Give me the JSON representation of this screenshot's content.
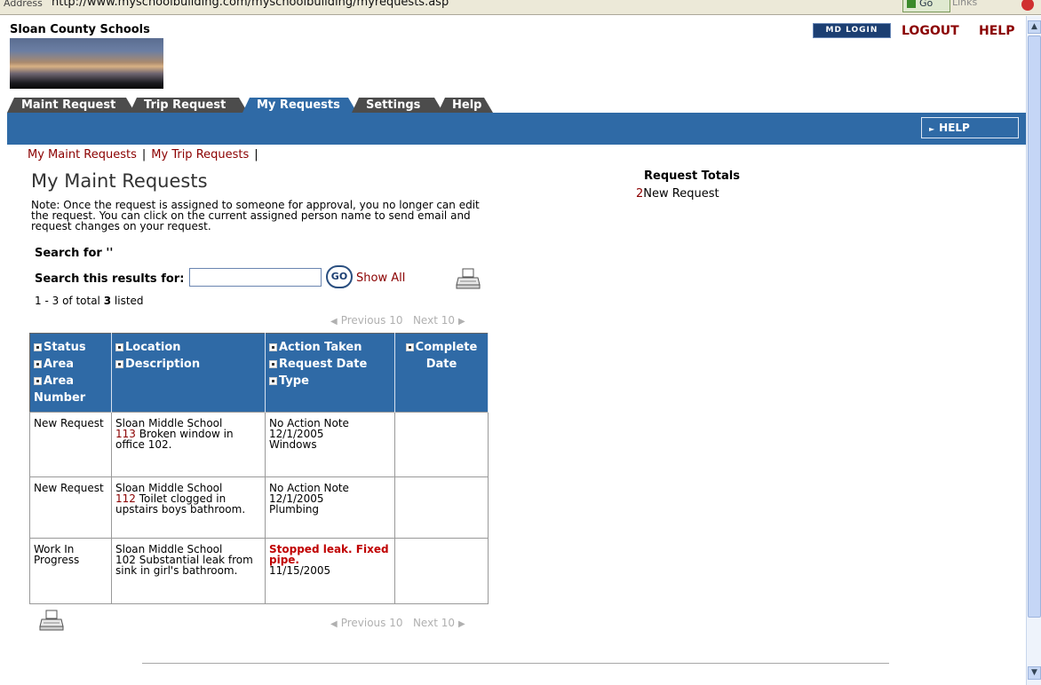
{
  "browser": {
    "address_label": "Address",
    "url": "http://www.myschoolbuilding.com/myschoolbuilding/myrequests.asp",
    "go_label": "Go",
    "links_label": "Links"
  },
  "header": {
    "school_name": "Sloan County Schools",
    "md_login": "MD LOGIN",
    "logout": "LOGOUT",
    "help": "HELP"
  },
  "tabs": [
    {
      "label": "Maint Request",
      "active": false
    },
    {
      "label": "Trip Request",
      "active": false
    },
    {
      "label": "My Requests",
      "active": true
    },
    {
      "label": "Settings",
      "active": false
    },
    {
      "label": "Help",
      "active": false
    }
  ],
  "help_button": "HELP",
  "sublinks": {
    "maint": "My Maint Requests",
    "trip": "My Trip Requests",
    "sep": "|"
  },
  "page_title": "My Maint Requests",
  "note": "Note: Once the request is assigned to someone for approval, you no longer can edit the request. You can click on the current assigned person name to send email and request changes on your request.",
  "search": {
    "for_label": "Search for ''",
    "results_label": "Search this results for:",
    "value": "",
    "go": "GO",
    "show_all": "Show All"
  },
  "listing": {
    "range": "1 - 3",
    "of_total": "of total",
    "total": "3",
    "listed": "listed"
  },
  "pager": {
    "previous": "Previous 10",
    "next": "Next 10"
  },
  "table": {
    "columns": [
      [
        "Status",
        "Area",
        "Area Number"
      ],
      [
        "Location",
        "Description"
      ],
      [
        "Action Taken",
        "Request Date",
        "Type"
      ],
      [
        "Complete Date"
      ]
    ],
    "rows": [
      {
        "status": "New Request",
        "location": "Sloan Middle School",
        "number": "113",
        "number_linked": true,
        "description": "Broken window in office 102.",
        "action": "No Action Note",
        "action_highlight": false,
        "date": "12/1/2005",
        "type": "Windows",
        "complete": ""
      },
      {
        "status": "New Request",
        "location": "Sloan Middle School",
        "number": "112",
        "number_linked": true,
        "description": "Toilet clogged in upstairs boys bathroom.",
        "action": "No Action Note",
        "action_highlight": false,
        "date": "12/1/2005",
        "type": "Plumbing",
        "complete": ""
      },
      {
        "status": "Work In Progress",
        "location": "Sloan Middle School",
        "number": "102",
        "number_linked": false,
        "description": "Substantial leak from sink in girl's bathroom.",
        "action": "Stopped leak. Fixed pipe.",
        "action_highlight": true,
        "date": "11/15/2005",
        "type": "",
        "complete": ""
      }
    ]
  },
  "totals": {
    "title": "Request Totals",
    "count": "2",
    "label": "New Request"
  },
  "colors": {
    "brand_blue": "#2f6aa6",
    "link_red": "#8b0000",
    "tab_gray": "#4c4c4c",
    "action_red": "#c00000"
  }
}
